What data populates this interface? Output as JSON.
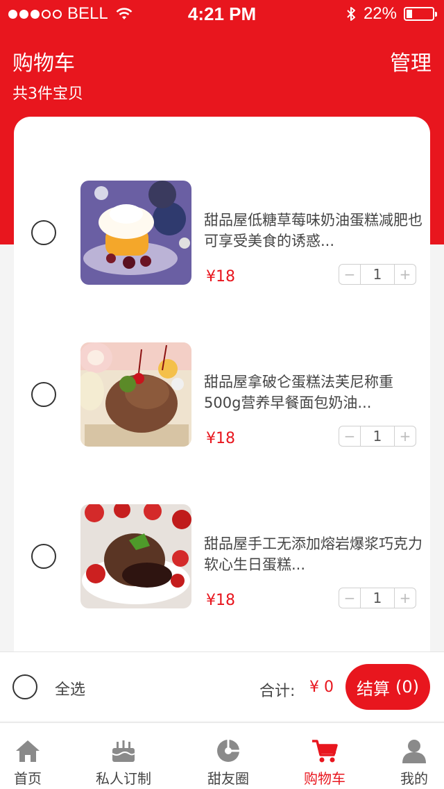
{
  "status_bar": {
    "carrier": "BELL",
    "time": "4:21 PM",
    "battery": "22%",
    "battery_level": 0.22
  },
  "header": {
    "title": "购物车",
    "manage": "管理",
    "count_text": "共3件宝贝"
  },
  "items": [
    {
      "name": "甜品屋低糖草莓味奶油蛋糕减肥也可享受美食的诱惑...",
      "price": "¥18",
      "quantity": "1",
      "minus": "−",
      "plus": "+",
      "thumb_icon": "cream-cake-image"
    },
    {
      "name": "甜品屋拿破仑蛋糕法芙尼称重500g营养早餐面包奶油...",
      "price": "¥18",
      "quantity": "1",
      "minus": "−",
      "plus": "+",
      "thumb_icon": "chocolate-roll-cake-image"
    },
    {
      "name": "甜品屋手工无添加熔岩爆浆巧克力软心生日蛋糕...",
      "price": "¥18",
      "quantity": "1",
      "minus": "−",
      "plus": "+",
      "thumb_icon": "lava-cake-image"
    }
  ],
  "summary": {
    "select_all": "全选",
    "total_label": "合计:",
    "total_value": "¥ 0",
    "checkout_label": "结算",
    "checkout_count": "(0)"
  },
  "tabbar": {
    "tabs": [
      {
        "label": "首页",
        "icon": "home-icon"
      },
      {
        "label": "私人订制",
        "icon": "cake-icon"
      },
      {
        "label": "甜友圈",
        "icon": "circle-pie-icon"
      },
      {
        "label": "购物车",
        "icon": "cart-icon"
      },
      {
        "label": "我的",
        "icon": "user-icon"
      }
    ],
    "active_index": 3
  },
  "colors": {
    "accent": "#e8161e",
    "text": "#444444",
    "inactive_icon": "#8a8a8a"
  }
}
